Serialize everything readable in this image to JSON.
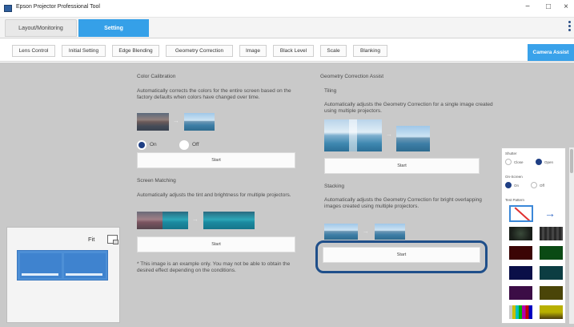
{
  "window": {
    "title": "Epson Projector Professional Tool",
    "minimize_glyph": "−",
    "maximize_glyph": "□",
    "close_glyph": "×"
  },
  "mode_tabs": [
    {
      "label": "Layout/Monitoring",
      "active": false
    },
    {
      "label": "Setting",
      "active": true
    }
  ],
  "function_tabs": [
    "Lens Control",
    "Initial Setting",
    "Edge Blending",
    "Geometry Correction",
    "Image",
    "Black Level",
    "Scale",
    "Blanking"
  ],
  "camera_assist_label": "Camera Assist",
  "color_calibration": {
    "title": "Color Calibration",
    "description": "Automatically corrects the colors for the entire screen based on the factory defaults when colors have changed over time.",
    "on_label": "On",
    "off_label": "Off",
    "selected": "On",
    "start_label": "Start"
  },
  "screen_matching": {
    "title": "Screen Matching",
    "description": "Automatically adjusts the tint and brightness for multiple projectors.",
    "start_label": "Start"
  },
  "note": "* This image is an example only. You may not be able to obtain the desired effect depending on the conditions.",
  "geometry_assist": {
    "title": "Geometry Correction Assist",
    "tiling": {
      "title": "Tiling",
      "description": "Automatically adjusts the Geometry Correction for a single image created using multiple projectors.",
      "start_label": "Start"
    },
    "stacking": {
      "title": "Stacking",
      "description": "Automatically adjusts the Geometry Correction for bright overlapping images created using multiple projectors.",
      "start_label": "Start"
    }
  },
  "preview": {
    "fit_label": "Fit"
  },
  "tool_panel": {
    "shutter_label": "Shutter",
    "shutter_close": "Close",
    "shutter_open": "Open",
    "shutter_selected": "Open",
    "onscreen_label": "On-Screen",
    "onscreen_on": "On",
    "onscreen_off": "Off",
    "onscreen_selected": "On",
    "test_pattern_label": "Test Pattern",
    "arrow_glyph": "→"
  },
  "colors": {
    "accent": "#35a0e8",
    "highlight": "#1f4f8a",
    "radio_selected": "#1f3f84"
  }
}
